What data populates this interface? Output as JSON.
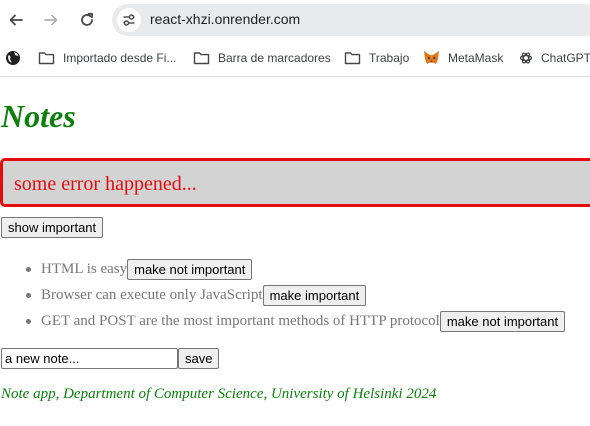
{
  "browser": {
    "url": "react-xhzi.onrender.com",
    "bookmarks": [
      {
        "label": "Importado desde Fi..."
      },
      {
        "label": "Barra de marcadores"
      },
      {
        "label": "Trabajo"
      },
      {
        "label": "MetaMask"
      },
      {
        "label": "ChatGPT"
      }
    ],
    "icons": {
      "back": "arrow-left-icon",
      "forward": "arrow-right-icon",
      "reload": "reload-icon",
      "site_info": "tune-icon",
      "globe": "globe-icon",
      "folder": "folder-icon",
      "metamask": "fox-icon",
      "chatgpt": "openai-icon"
    }
  },
  "page": {
    "title": "Notes",
    "error_message": "some error happened...",
    "show_toggle_label": "show important",
    "notes": [
      {
        "content": "HTML is easy",
        "button_label": "make not important"
      },
      {
        "content": "Browser can execute only JavaScript",
        "button_label": "make important"
      },
      {
        "content": "GET and POST are the most important methods of HTTP protocol",
        "button_label": "make not important"
      }
    ],
    "new_note_input_value": "a new note...",
    "save_label": "save",
    "footer": "Note app, Department of Computer Science, University of Helsinki 2024"
  },
  "colors": {
    "title_green": "#0b800b",
    "error_red": "#e40d0d",
    "error_bg": "#d3d3d3",
    "note_gray": "#777777"
  }
}
